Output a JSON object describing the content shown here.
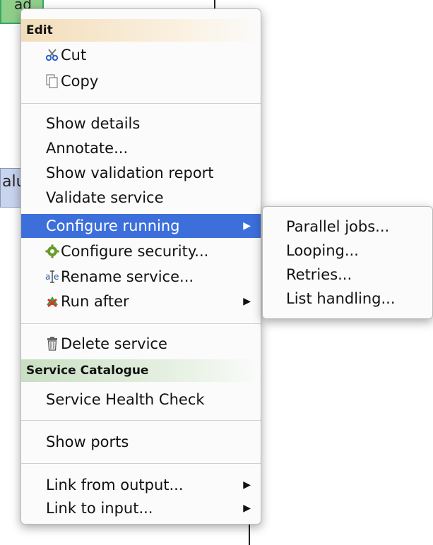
{
  "background": {
    "node_top_label": "ad",
    "node_mid_label": "alu"
  },
  "menu": {
    "sections": {
      "edit_header": "Edit",
      "catalogue_header": "Service Catalogue"
    },
    "items": {
      "cut": "Cut",
      "copy": "Copy",
      "show_details": "Show details",
      "annotate": "Annotate...",
      "show_validation_report": "Show validation report",
      "validate_service": "Validate service",
      "configure_running": "Configure running",
      "configure_security": "Configure security...",
      "rename_service": "Rename service...",
      "run_after": "Run after",
      "delete_service": "Delete service",
      "service_health_check": "Service Health Check",
      "show_ports": "Show ports",
      "link_from_output": "Link from output...",
      "link_to_input": "Link to input..."
    },
    "submenu_arrow": "▶"
  },
  "submenu": {
    "items": [
      "Parallel jobs...",
      "Looping...",
      "Retries...",
      "List handling..."
    ]
  },
  "colors": {
    "highlight": "#3d6fdb",
    "edit_header": "#f2ddb9",
    "catalogue_header": "#c8dfc2"
  }
}
